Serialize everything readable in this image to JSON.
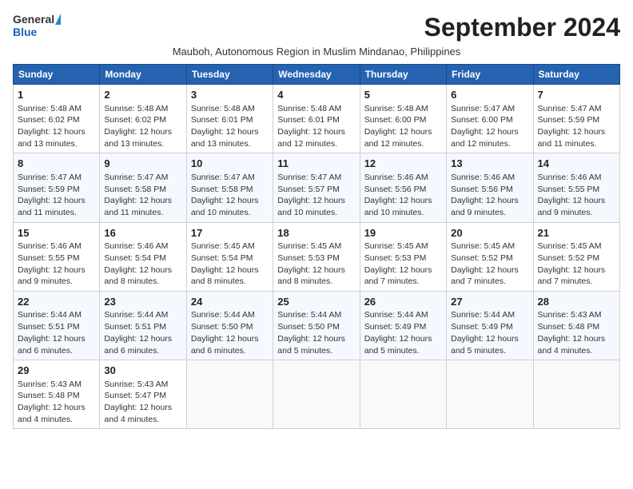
{
  "header": {
    "logo_general": "General",
    "logo_blue": "Blue",
    "month_title": "September 2024",
    "subtitle": "Mauboh, Autonomous Region in Muslim Mindanao, Philippines"
  },
  "weekdays": [
    "Sunday",
    "Monday",
    "Tuesday",
    "Wednesday",
    "Thursday",
    "Friday",
    "Saturday"
  ],
  "weeks": [
    [
      {
        "day": "1",
        "info": "Sunrise: 5:48 AM\nSunset: 6:02 PM\nDaylight: 12 hours\nand 13 minutes."
      },
      {
        "day": "2",
        "info": "Sunrise: 5:48 AM\nSunset: 6:02 PM\nDaylight: 12 hours\nand 13 minutes."
      },
      {
        "day": "3",
        "info": "Sunrise: 5:48 AM\nSunset: 6:01 PM\nDaylight: 12 hours\nand 13 minutes."
      },
      {
        "day": "4",
        "info": "Sunrise: 5:48 AM\nSunset: 6:01 PM\nDaylight: 12 hours\nand 12 minutes."
      },
      {
        "day": "5",
        "info": "Sunrise: 5:48 AM\nSunset: 6:00 PM\nDaylight: 12 hours\nand 12 minutes."
      },
      {
        "day": "6",
        "info": "Sunrise: 5:47 AM\nSunset: 6:00 PM\nDaylight: 12 hours\nand 12 minutes."
      },
      {
        "day": "7",
        "info": "Sunrise: 5:47 AM\nSunset: 5:59 PM\nDaylight: 12 hours\nand 11 minutes."
      }
    ],
    [
      {
        "day": "8",
        "info": "Sunrise: 5:47 AM\nSunset: 5:59 PM\nDaylight: 12 hours\nand 11 minutes."
      },
      {
        "day": "9",
        "info": "Sunrise: 5:47 AM\nSunset: 5:58 PM\nDaylight: 12 hours\nand 11 minutes."
      },
      {
        "day": "10",
        "info": "Sunrise: 5:47 AM\nSunset: 5:58 PM\nDaylight: 12 hours\nand 10 minutes."
      },
      {
        "day": "11",
        "info": "Sunrise: 5:47 AM\nSunset: 5:57 PM\nDaylight: 12 hours\nand 10 minutes."
      },
      {
        "day": "12",
        "info": "Sunrise: 5:46 AM\nSunset: 5:56 PM\nDaylight: 12 hours\nand 10 minutes."
      },
      {
        "day": "13",
        "info": "Sunrise: 5:46 AM\nSunset: 5:56 PM\nDaylight: 12 hours\nand 9 minutes."
      },
      {
        "day": "14",
        "info": "Sunrise: 5:46 AM\nSunset: 5:55 PM\nDaylight: 12 hours\nand 9 minutes."
      }
    ],
    [
      {
        "day": "15",
        "info": "Sunrise: 5:46 AM\nSunset: 5:55 PM\nDaylight: 12 hours\nand 9 minutes."
      },
      {
        "day": "16",
        "info": "Sunrise: 5:46 AM\nSunset: 5:54 PM\nDaylight: 12 hours\nand 8 minutes."
      },
      {
        "day": "17",
        "info": "Sunrise: 5:45 AM\nSunset: 5:54 PM\nDaylight: 12 hours\nand 8 minutes."
      },
      {
        "day": "18",
        "info": "Sunrise: 5:45 AM\nSunset: 5:53 PM\nDaylight: 12 hours\nand 8 minutes."
      },
      {
        "day": "19",
        "info": "Sunrise: 5:45 AM\nSunset: 5:53 PM\nDaylight: 12 hours\nand 7 minutes."
      },
      {
        "day": "20",
        "info": "Sunrise: 5:45 AM\nSunset: 5:52 PM\nDaylight: 12 hours\nand 7 minutes."
      },
      {
        "day": "21",
        "info": "Sunrise: 5:45 AM\nSunset: 5:52 PM\nDaylight: 12 hours\nand 7 minutes."
      }
    ],
    [
      {
        "day": "22",
        "info": "Sunrise: 5:44 AM\nSunset: 5:51 PM\nDaylight: 12 hours\nand 6 minutes."
      },
      {
        "day": "23",
        "info": "Sunrise: 5:44 AM\nSunset: 5:51 PM\nDaylight: 12 hours\nand 6 minutes."
      },
      {
        "day": "24",
        "info": "Sunrise: 5:44 AM\nSunset: 5:50 PM\nDaylight: 12 hours\nand 6 minutes."
      },
      {
        "day": "25",
        "info": "Sunrise: 5:44 AM\nSunset: 5:50 PM\nDaylight: 12 hours\nand 5 minutes."
      },
      {
        "day": "26",
        "info": "Sunrise: 5:44 AM\nSunset: 5:49 PM\nDaylight: 12 hours\nand 5 minutes."
      },
      {
        "day": "27",
        "info": "Sunrise: 5:44 AM\nSunset: 5:49 PM\nDaylight: 12 hours\nand 5 minutes."
      },
      {
        "day": "28",
        "info": "Sunrise: 5:43 AM\nSunset: 5:48 PM\nDaylight: 12 hours\nand 4 minutes."
      }
    ],
    [
      {
        "day": "29",
        "info": "Sunrise: 5:43 AM\nSunset: 5:48 PM\nDaylight: 12 hours\nand 4 minutes."
      },
      {
        "day": "30",
        "info": "Sunrise: 5:43 AM\nSunset: 5:47 PM\nDaylight: 12 hours\nand 4 minutes."
      },
      {
        "day": "",
        "info": ""
      },
      {
        "day": "",
        "info": ""
      },
      {
        "day": "",
        "info": ""
      },
      {
        "day": "",
        "info": ""
      },
      {
        "day": "",
        "info": ""
      }
    ]
  ]
}
